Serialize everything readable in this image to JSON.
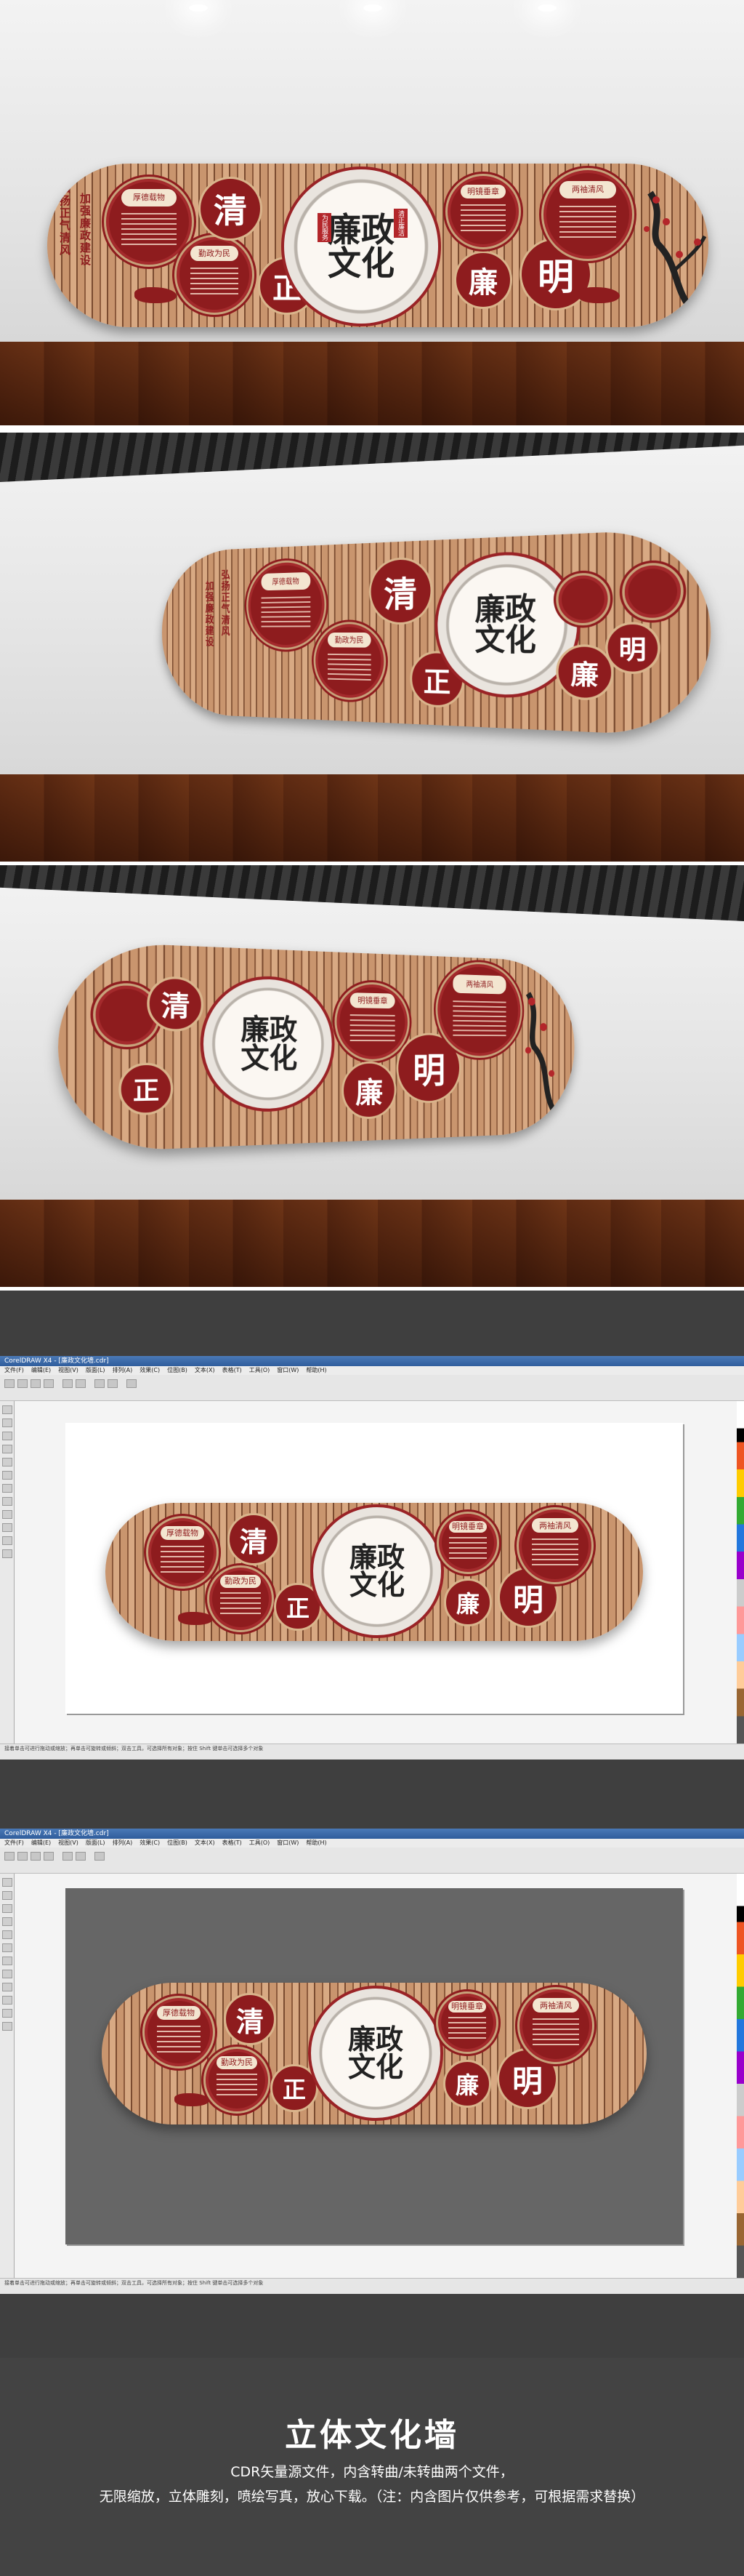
{
  "wall": {
    "big_chars": [
      "清",
      "正",
      "廉",
      "明"
    ],
    "center_title": "廉政文化",
    "center_seal_left": "为民服务",
    "center_seal_right": "清正廉洁",
    "slogan_1": "弘扬正气清风",
    "slogan_2": "加强廉政建设",
    "circle_titles": [
      "厚德载物",
      "勤政为民",
      "明镜垂章",
      "两袖清风"
    ]
  },
  "cdr_window": {
    "title": "CorelDRAW X4 - [廉政文化墙.cdr]",
    "menu": [
      "文件(F)",
      "编辑(E)",
      "视图(V)",
      "版面(L)",
      "排列(A)",
      "效果(C)",
      "位图(B)",
      "文本(X)",
      "表格(T)",
      "工具(O)",
      "窗口(W)",
      "帮助(H)"
    ],
    "status": "接着单击可进行拖动或缩放；再单击可旋转或倾斜；双击工具，可选择所有对象；按住 Shift 键单击可选择多个对象"
  },
  "footer": {
    "heading": "立体文化墙",
    "desc_line1": "CDR矢量源文件，内含转曲/未转曲两个文件，",
    "desc_line2": "无限缩放，立体雕刻，喷绘写真，放心下载。（注：内含图片仅供参考，可根据需求替换）"
  },
  "colors": {
    "brand_red": "#8e1c1e",
    "wood": "#c9956e",
    "footer_bg": "#434343"
  }
}
